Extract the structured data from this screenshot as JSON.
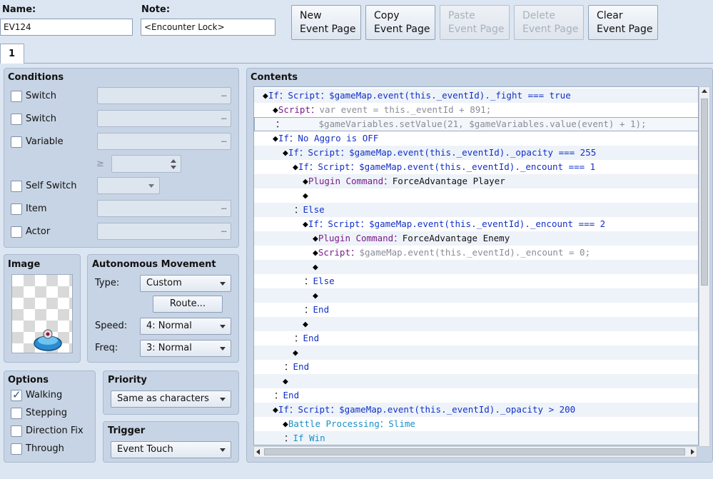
{
  "header": {
    "name_label": "Name:",
    "name_value": "EV124",
    "note_label": "Note:",
    "note_value": "<Encounter Lock>"
  },
  "toolbar": {
    "new_line1": "New",
    "new_line2": "Event Page",
    "copy_line1": "Copy",
    "copy_line2": "Event Page",
    "paste_line1": "Paste",
    "paste_line2": "Event Page",
    "delete_line1": "Delete",
    "delete_line2": "Event Page",
    "clear_line1": "Clear",
    "clear_line2": "Event Page"
  },
  "tabs": [
    {
      "label": "1"
    }
  ],
  "conditions": {
    "title": "Conditions",
    "switch1": "Switch",
    "switch2": "Switch",
    "variable": "Variable",
    "ge": "≥",
    "self_switch": "Self Switch",
    "item": "Item",
    "actor": "Actor",
    "dots": "..."
  },
  "image": {
    "title": "Image"
  },
  "movement": {
    "title": "Autonomous Movement",
    "type_label": "Type:",
    "type_value": "Custom",
    "route_label": "Route...",
    "speed_label": "Speed:",
    "speed_value": "4: Normal",
    "freq_label": "Freq:",
    "freq_value": "3: Normal"
  },
  "options": {
    "title": "Options",
    "walking": "Walking",
    "walking_checked": true,
    "stepping": "Stepping",
    "direction_fix": "Direction Fix",
    "through": "Through"
  },
  "priority": {
    "title": "Priority",
    "value": "Same as characters"
  },
  "trigger": {
    "title": "Trigger",
    "value": "Event Touch"
  },
  "contents": {
    "title": "Contents",
    "rows": [
      {
        "prefix": "◆",
        "kw": "If",
        "sep": "：",
        "kw2": "Script",
        "sep2": "：",
        "rest": "$gameMap.event(this._eventId)._fight === true"
      },
      {
        "prefix": "◆",
        "kw": "Script",
        "sep": "：",
        "rest": "var event = this._eventId + 891;"
      },
      {
        "prefix": "：",
        "rest": "$gameVariables.setValue(21, $gameVariables.value(event) + 1);"
      },
      {
        "prefix": "◆",
        "kw": "If",
        "sep": "：",
        "rest": "No Aggro is OFF"
      },
      {
        "prefix": "◆",
        "kw": "If",
        "sep": "：",
        "kw2": "Script",
        "sep2": "：",
        "rest": "$gameMap.event(this._eventId)._opacity === 255"
      },
      {
        "prefix": "◆",
        "kw": "If",
        "sep": "：",
        "kw2": "Script",
        "sep2": "：",
        "rest": "$gameMap.event(this._eventId)._encount === 1"
      },
      {
        "prefix": "◆",
        "kw": "Plugin Command",
        "sep": "：",
        "rest": "ForceAdvantage Player"
      },
      {
        "prefix": "◆"
      },
      {
        "prefix": "：",
        "kw": "Else"
      },
      {
        "prefix": "◆",
        "kw": "If",
        "sep": "：",
        "kw2": "Script",
        "sep2": "：",
        "rest": "$gameMap.event(this._eventId)._encount === 2"
      },
      {
        "prefix": "◆",
        "kw": "Plugin Command",
        "sep": "：",
        "rest": "ForceAdvantage Enemy"
      },
      {
        "prefix": "◆",
        "kw": "Script",
        "sep": "：",
        "rest": "$gameMap.event(this._eventId)._encount = 0;"
      },
      {
        "prefix": "◆"
      },
      {
        "prefix": "：",
        "kw": "Else"
      },
      {
        "prefix": "◆"
      },
      {
        "prefix": "：",
        "kw": "End"
      },
      {
        "prefix": "◆"
      },
      {
        "prefix": "：",
        "kw": "End"
      },
      {
        "prefix": "◆"
      },
      {
        "prefix": "：",
        "kw": "End"
      },
      {
        "prefix": "◆"
      },
      {
        "prefix": "：",
        "kw": "End"
      },
      {
        "prefix": "◆",
        "kw": "If",
        "sep": "：",
        "kw2": "Script",
        "sep2": "：",
        "rest": "$gameMap.event(this._eventId)._opacity > 200"
      },
      {
        "prefix": "◆",
        "kw": "Battle Processing",
        "sep": "：",
        "rest": "Slime"
      },
      {
        "prefix": "：",
        "kw": "If Win"
      }
    ]
  }
}
